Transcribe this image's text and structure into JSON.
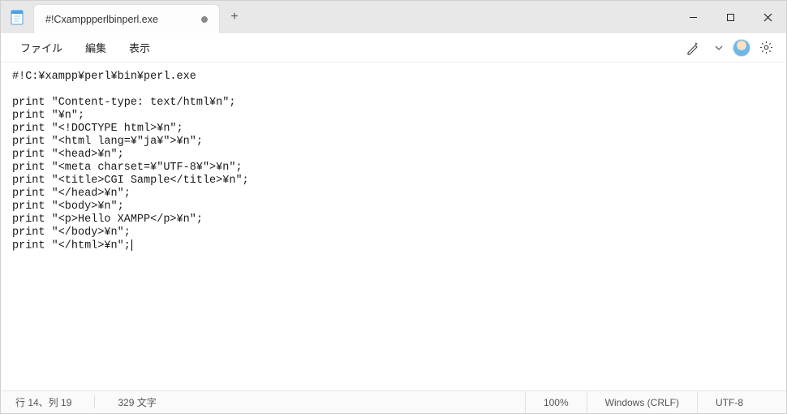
{
  "titlebar": {
    "tab_title": "#!Cxamppperlbinperl.exe",
    "new_tab_glyph": "+"
  },
  "menu": {
    "file": "ファイル",
    "edit": "編集",
    "view": "表示"
  },
  "editor": {
    "content": "#!C:¥xampp¥perl¥bin¥perl.exe\n\nprint \"Content-type: text/html¥n\";\nprint \"¥n\";\nprint \"<!DOCTYPE html>¥n\";\nprint \"<html lang=¥\"ja¥\">¥n\";\nprint \"<head>¥n\";\nprint \"<meta charset=¥\"UTF-8¥\">¥n\";\nprint \"<title>CGI Sample</title>¥n\";\nprint \"</head>¥n\";\nprint \"<body>¥n\";\nprint \"<p>Hello XAMPP</p>¥n\";\nprint \"</body>¥n\";\nprint \"</html>¥n\";"
  },
  "status": {
    "position": "行 14、列 19",
    "chars": "329 文字",
    "zoom": "100%",
    "line_ending": "Windows (CRLF)",
    "encoding": "UTF-8"
  },
  "icons": {
    "ai": "ai-sparkle-icon",
    "dropdown": "chevron-down-icon",
    "avatar": "user-avatar",
    "settings": "gear-icon",
    "minimize": "minimize-icon",
    "maximize": "maximize-icon",
    "close": "close-icon",
    "app": "notepad-icon"
  }
}
